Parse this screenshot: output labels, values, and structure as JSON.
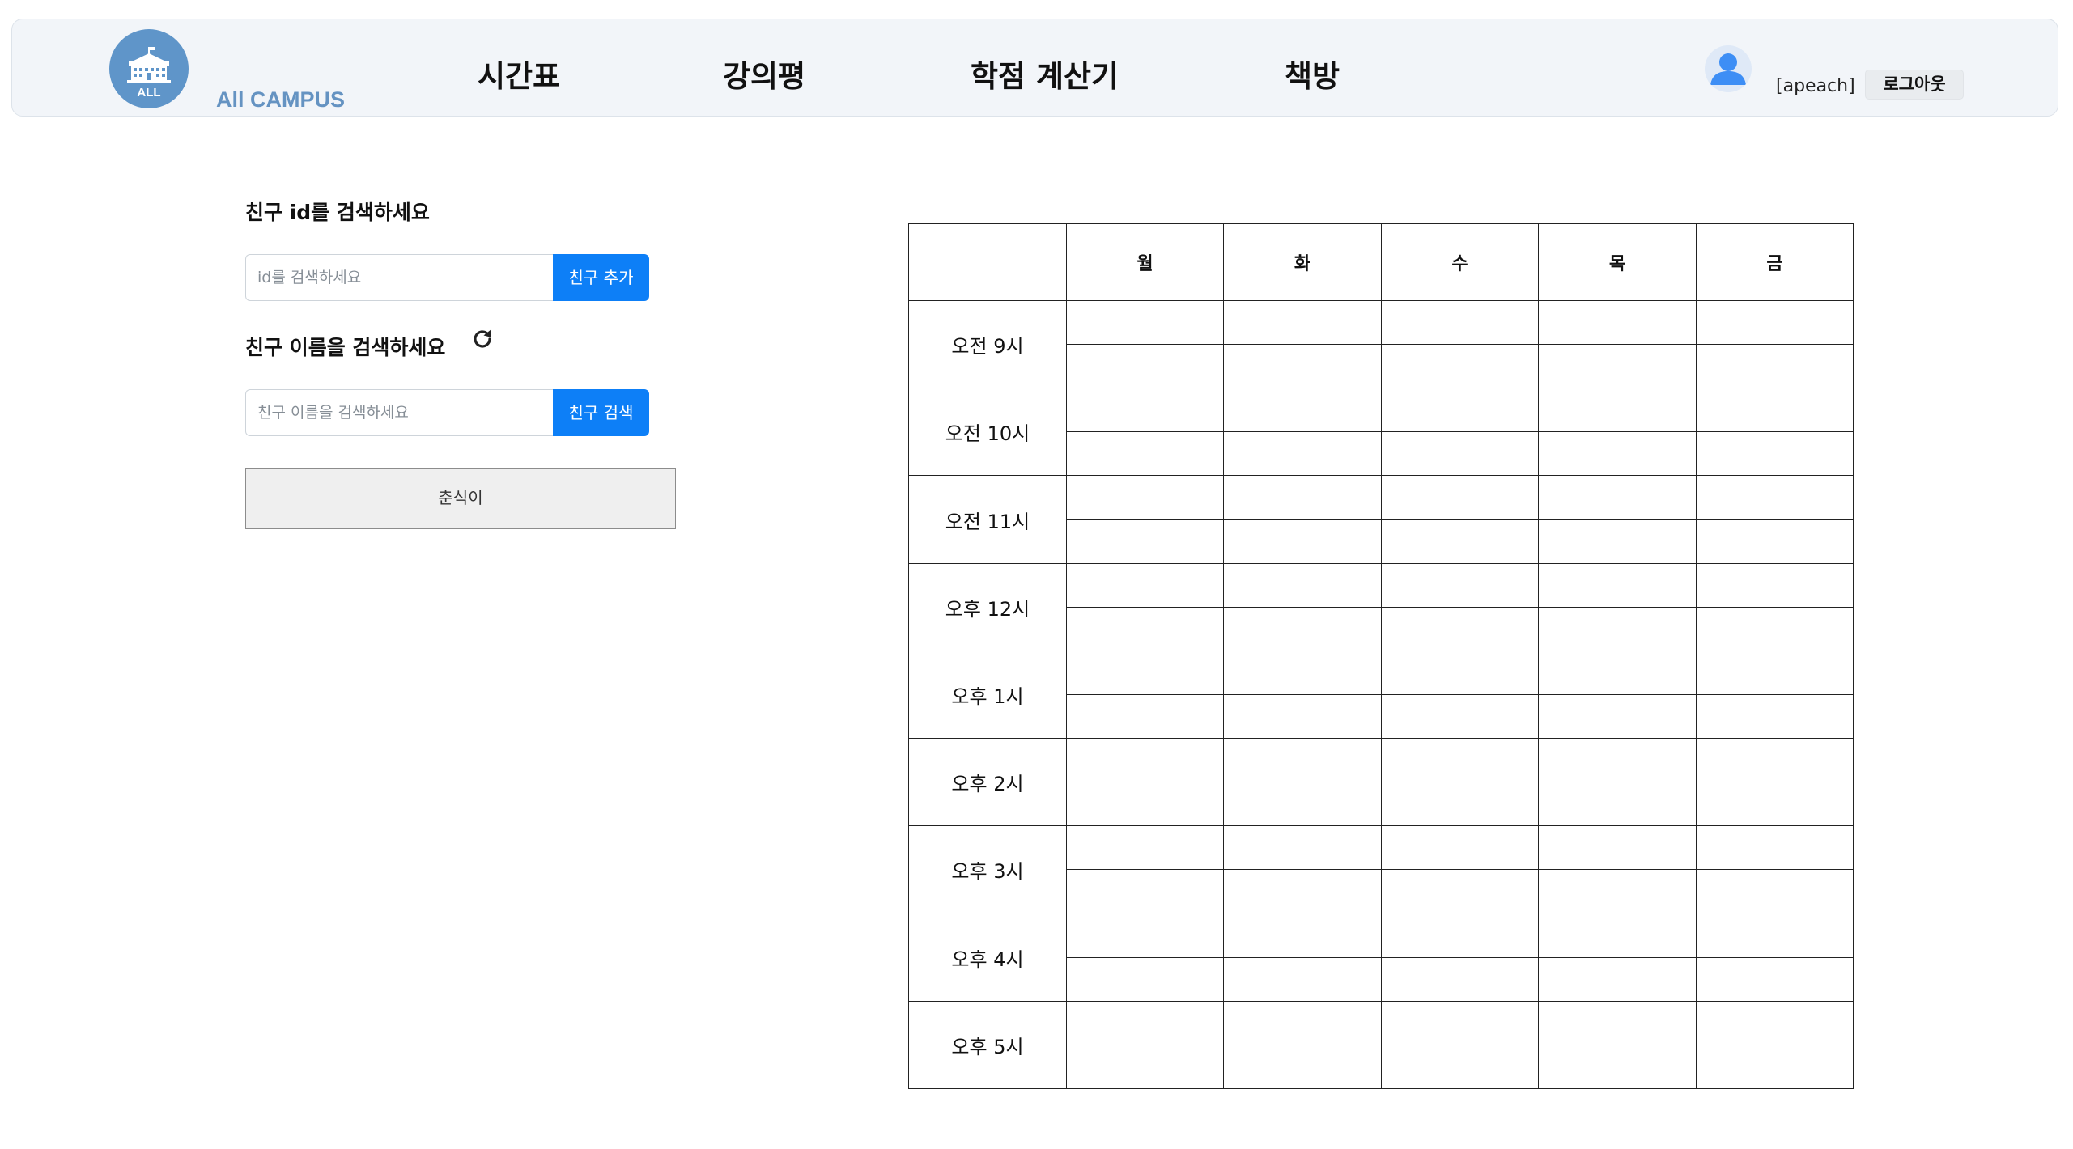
{
  "header": {
    "logo_badge_text": "ALL",
    "brand": "All CAMPUS",
    "nav": [
      {
        "label": "시간표"
      },
      {
        "label": "강의평"
      },
      {
        "label": "학점 계산기"
      },
      {
        "label": "책방"
      }
    ],
    "user": {
      "name": "[apeach]",
      "logout_label": "로그아웃",
      "avatar_icon": "user-icon"
    },
    "colors": {
      "background": "#f2f5f9",
      "brand": "#6593c2",
      "logo_badge": "#5f95c9"
    }
  },
  "friends": {
    "id_search": {
      "title": "친구 id를 검색하세요",
      "placeholder": "id를 검색하세요",
      "value": "",
      "button_label": "친구 추가"
    },
    "name_search": {
      "title": "친구 이름을 검색하세요",
      "refresh_icon": "refresh-icon",
      "placeholder": "친구 이름을 검색하세요",
      "value": "",
      "button_label": "친구 검색"
    },
    "list": [
      {
        "name": "춘식이"
      }
    ],
    "colors": {
      "button": "#0d7ff7"
    }
  },
  "timetable": {
    "corner": "",
    "days": [
      "월",
      "화",
      "수",
      "목",
      "금"
    ],
    "times": [
      "오전 9시",
      "오전 10시",
      "오전 11시",
      "오후 12시",
      "오후 1시",
      "오후 2시",
      "오후 3시",
      "오후 4시",
      "오후 5시"
    ],
    "half_slots_per_hour": 2
  }
}
